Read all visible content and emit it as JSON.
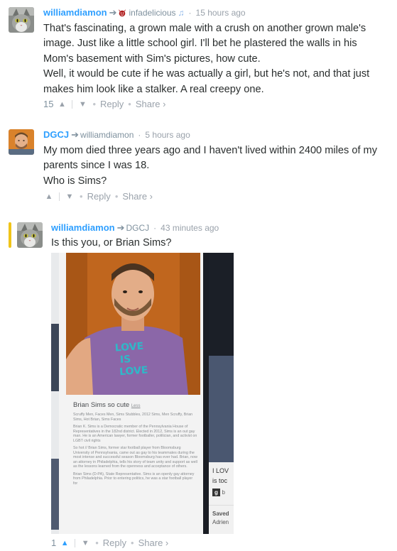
{
  "comments": [
    {
      "author": "williamdiamon",
      "reply_to": "infadelicious",
      "time": "15 hours ago",
      "paragraphs": [
        "That's fascinating, a grown male with a crush on another grown male's image. Just like a little school girl. I'll bet he plastered the walls in his Mom's basement with Sim's pictures, how cute.",
        "Well, it would be cute if he was actually a girl, but he's not, and that just makes him look like a stalker. A real creepy one."
      ],
      "votes": "15",
      "reply_label": "Reply",
      "share_label": "Share ›"
    },
    {
      "author": "DGCJ",
      "reply_to": "williamdiamon",
      "time": "5 hours ago",
      "paragraphs": [
        "My mom died three years ago and I haven't lived within 2400 miles of my parents since I was 18.",
        "Who is Sims?"
      ],
      "votes": "",
      "reply_label": "Reply",
      "share_label": "Share ›"
    },
    {
      "author": "williamdiamon",
      "reply_to": "DGCJ",
      "time": "43 minutes ago",
      "paragraphs": [
        "Is this you, or Brian Sims?"
      ],
      "votes": "1",
      "reply_label": "Reply",
      "share_label": "Share ›"
    }
  ],
  "embed": {
    "shirt_text_1": "LOVE",
    "shirt_text_2": "IS",
    "shirt_text_3": "LOVE",
    "card_title": "Brian Sims so cute",
    "card_less": "Less",
    "card_tags": "Scruffy Men, Faces Men, Sims Stubbles, 2012 Sims, Men Scruffy, Brian Sims, Hot Brian, Sims Faces",
    "card_desc_1": "Brian K. Sims is a Democratic member of the Pennsylvania House of Representatives in the 182nd district. Elected in 2012, Sims is an out gay man. He is an American lawyer, former footballer, politician, and activist on LGBT civil rights",
    "card_desc_2": "So hot // Brian Sims, former star football player from Bloomsburg University of Pennsylvania, came out as gay to his teammates during the most intense and successful season Bloomsburg has ever had. Brian, now an attorney in Philadelphia, tells his story of team unity and support as well as the lessons learned from the openness and acceptance of others.",
    "card_desc_3": "Brian Sims (D-PA), State Representative. Sims is an openly gay attorney from Philadelphia. Prior to entering politics, he was a star football player for",
    "right_text_1": "I LOV",
    "right_text_2": "is toc",
    "right_badge": "g",
    "right_small": "b",
    "right_saved": "Saved",
    "right_name": "Adrien"
  },
  "colors": {
    "author": "#2e9fff",
    "highlight": "#f0c419",
    "text": "#2a2e2e",
    "muted": "#9aa2ab",
    "photo_orange": "#c0661e",
    "shirt_purple": "#8b67a8"
  },
  "icons": {
    "reply_arrow": "arrow-right-icon",
    "upvote": "chevron-up-icon",
    "downvote": "chevron-down-icon",
    "music": "music-note-icon",
    "devil_badge": "devil-face-icon"
  }
}
